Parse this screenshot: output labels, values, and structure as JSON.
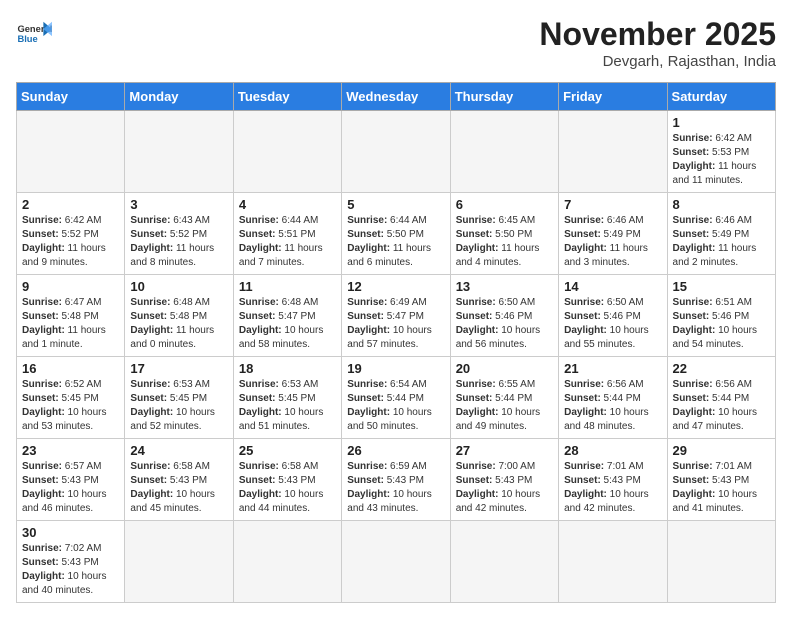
{
  "header": {
    "logo_general": "General",
    "logo_blue": "Blue",
    "month_title": "November 2025",
    "location": "Devgarh, Rajasthan, India"
  },
  "weekdays": [
    "Sunday",
    "Monday",
    "Tuesday",
    "Wednesday",
    "Thursday",
    "Friday",
    "Saturday"
  ],
  "weeks": [
    [
      {
        "day": "",
        "empty": true
      },
      {
        "day": "",
        "empty": true
      },
      {
        "day": "",
        "empty": true
      },
      {
        "day": "",
        "empty": true
      },
      {
        "day": "",
        "empty": true
      },
      {
        "day": "",
        "empty": true
      },
      {
        "day": "1",
        "sunrise": "6:42 AM",
        "sunset": "5:53 PM",
        "daylight": "11 hours and 11 minutes."
      }
    ],
    [
      {
        "day": "2",
        "sunrise": "6:42 AM",
        "sunset": "5:52 PM",
        "daylight": "11 hours and 9 minutes."
      },
      {
        "day": "3",
        "sunrise": "6:43 AM",
        "sunset": "5:52 PM",
        "daylight": "11 hours and 8 minutes."
      },
      {
        "day": "4",
        "sunrise": "6:44 AM",
        "sunset": "5:51 PM",
        "daylight": "11 hours and 7 minutes."
      },
      {
        "day": "5",
        "sunrise": "6:44 AM",
        "sunset": "5:50 PM",
        "daylight": "11 hours and 6 minutes."
      },
      {
        "day": "6",
        "sunrise": "6:45 AM",
        "sunset": "5:50 PM",
        "daylight": "11 hours and 4 minutes."
      },
      {
        "day": "7",
        "sunrise": "6:46 AM",
        "sunset": "5:49 PM",
        "daylight": "11 hours and 3 minutes."
      },
      {
        "day": "8",
        "sunrise": "6:46 AM",
        "sunset": "5:49 PM",
        "daylight": "11 hours and 2 minutes."
      }
    ],
    [
      {
        "day": "9",
        "sunrise": "6:47 AM",
        "sunset": "5:48 PM",
        "daylight": "11 hours and 1 minute."
      },
      {
        "day": "10",
        "sunrise": "6:48 AM",
        "sunset": "5:48 PM",
        "daylight": "11 hours and 0 minutes."
      },
      {
        "day": "11",
        "sunrise": "6:48 AM",
        "sunset": "5:47 PM",
        "daylight": "10 hours and 58 minutes."
      },
      {
        "day": "12",
        "sunrise": "6:49 AM",
        "sunset": "5:47 PM",
        "daylight": "10 hours and 57 minutes."
      },
      {
        "day": "13",
        "sunrise": "6:50 AM",
        "sunset": "5:46 PM",
        "daylight": "10 hours and 56 minutes."
      },
      {
        "day": "14",
        "sunrise": "6:50 AM",
        "sunset": "5:46 PM",
        "daylight": "10 hours and 55 minutes."
      },
      {
        "day": "15",
        "sunrise": "6:51 AM",
        "sunset": "5:46 PM",
        "daylight": "10 hours and 54 minutes."
      }
    ],
    [
      {
        "day": "16",
        "sunrise": "6:52 AM",
        "sunset": "5:45 PM",
        "daylight": "10 hours and 53 minutes."
      },
      {
        "day": "17",
        "sunrise": "6:53 AM",
        "sunset": "5:45 PM",
        "daylight": "10 hours and 52 minutes."
      },
      {
        "day": "18",
        "sunrise": "6:53 AM",
        "sunset": "5:45 PM",
        "daylight": "10 hours and 51 minutes."
      },
      {
        "day": "19",
        "sunrise": "6:54 AM",
        "sunset": "5:44 PM",
        "daylight": "10 hours and 50 minutes."
      },
      {
        "day": "20",
        "sunrise": "6:55 AM",
        "sunset": "5:44 PM",
        "daylight": "10 hours and 49 minutes."
      },
      {
        "day": "21",
        "sunrise": "6:56 AM",
        "sunset": "5:44 PM",
        "daylight": "10 hours and 48 minutes."
      },
      {
        "day": "22",
        "sunrise": "6:56 AM",
        "sunset": "5:44 PM",
        "daylight": "10 hours and 47 minutes."
      }
    ],
    [
      {
        "day": "23",
        "sunrise": "6:57 AM",
        "sunset": "5:43 PM",
        "daylight": "10 hours and 46 minutes."
      },
      {
        "day": "24",
        "sunrise": "6:58 AM",
        "sunset": "5:43 PM",
        "daylight": "10 hours and 45 minutes."
      },
      {
        "day": "25",
        "sunrise": "6:58 AM",
        "sunset": "5:43 PM",
        "daylight": "10 hours and 44 minutes."
      },
      {
        "day": "26",
        "sunrise": "6:59 AM",
        "sunset": "5:43 PM",
        "daylight": "10 hours and 43 minutes."
      },
      {
        "day": "27",
        "sunrise": "7:00 AM",
        "sunset": "5:43 PM",
        "daylight": "10 hours and 42 minutes."
      },
      {
        "day": "28",
        "sunrise": "7:01 AM",
        "sunset": "5:43 PM",
        "daylight": "10 hours and 42 minutes."
      },
      {
        "day": "29",
        "sunrise": "7:01 AM",
        "sunset": "5:43 PM",
        "daylight": "10 hours and 41 minutes."
      }
    ],
    [
      {
        "day": "30",
        "sunrise": "7:02 AM",
        "sunset": "5:43 PM",
        "daylight": "10 hours and 40 minutes."
      },
      {
        "day": "",
        "empty": true
      },
      {
        "day": "",
        "empty": true
      },
      {
        "day": "",
        "empty": true
      },
      {
        "day": "",
        "empty": true
      },
      {
        "day": "",
        "empty": true
      },
      {
        "day": "",
        "empty": true
      }
    ]
  ],
  "labels": {
    "sunrise": "Sunrise:",
    "sunset": "Sunset:",
    "daylight": "Daylight:"
  }
}
